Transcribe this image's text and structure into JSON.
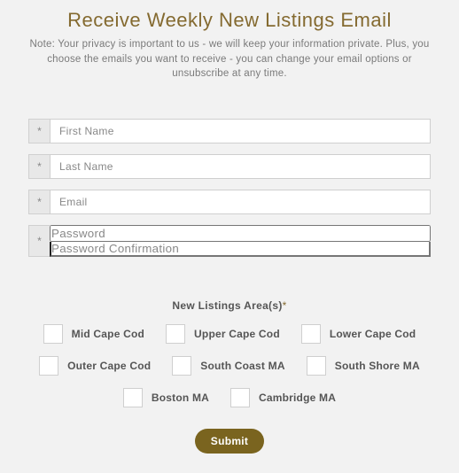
{
  "heading": "Receive Weekly New Listings Email",
  "note": "Note: Your privacy is important to us - we will keep your information private. Plus, you choose the emails you want to receive - you can change your email options or unsubscribe at any time.",
  "required_marker": "*",
  "fields": {
    "first_name": {
      "placeholder": "First Name",
      "value": ""
    },
    "last_name": {
      "placeholder": "Last Name",
      "value": ""
    },
    "email": {
      "placeholder": "Email",
      "value": ""
    },
    "password": {
      "placeholder": "Password",
      "value": ""
    },
    "password_confirmation": {
      "placeholder": "Password Confirmation",
      "value": ""
    }
  },
  "areas": {
    "title": "New Listings Area(s)",
    "required_marker": "*",
    "options": [
      "Mid Cape Cod",
      "Upper Cape Cod",
      "Lower Cape Cod",
      "Outer Cape Cod",
      "South Coast MA",
      "South Shore MA",
      "Boston MA",
      "Cambridge MA"
    ]
  },
  "submit_label": "Submit"
}
